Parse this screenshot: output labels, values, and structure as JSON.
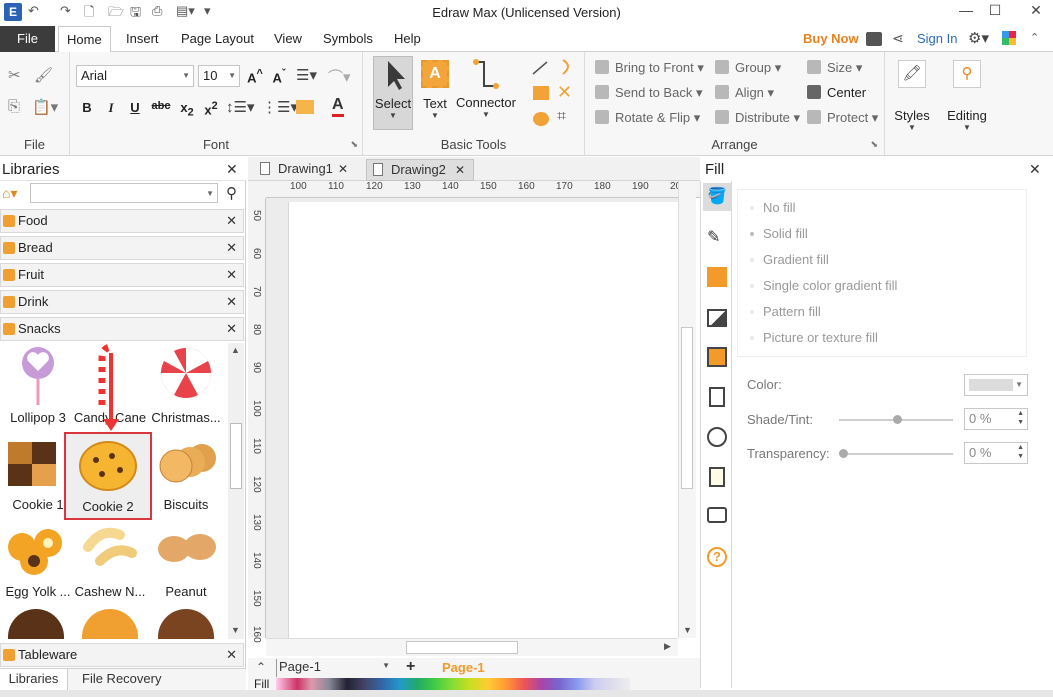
{
  "app": {
    "title": "Edraw Max (Unlicensed Version)"
  },
  "menu": {
    "file": "File",
    "tabs": [
      "Home",
      "Insert",
      "Page Layout",
      "View",
      "Symbols",
      "Help"
    ],
    "buy_now": "Buy Now",
    "sign_in": "Sign In"
  },
  "ribbon": {
    "file_group": "File",
    "font_group": "Font",
    "font_name": "Arial",
    "font_size": "10",
    "basic_tools_group": "Basic Tools",
    "select": "Select",
    "text": "Text",
    "connector": "Connector",
    "arrange_group": "Arrange",
    "bring_to_front": "Bring to Front",
    "send_to_back": "Send to Back",
    "rotate_flip": "Rotate & Flip",
    "group": "Group",
    "align": "Align",
    "distribute": "Distribute",
    "size": "Size",
    "center": "Center",
    "protect": "Protect",
    "styles": "Styles",
    "editing": "Editing"
  },
  "libraries": {
    "title": "Libraries",
    "categories": [
      "Food",
      "Bread",
      "Fruit",
      "Drink",
      "Snacks"
    ],
    "shapes": [
      "Lollipop 3",
      "Candy Cane",
      "Christmas...",
      "Cookie 1",
      "Cookie 2",
      "Biscuits",
      "Egg Yolk ...",
      "Cashew N...",
      "Peanut"
    ],
    "tableware": "Tableware",
    "bottom_tabs": [
      "Libraries",
      "File Recovery"
    ]
  },
  "documents": {
    "tabs": [
      "Drawing1",
      "Drawing2"
    ],
    "ruler_top": [
      "100",
      "110",
      "120",
      "130",
      "140",
      "150",
      "160",
      "170",
      "180",
      "190",
      "20"
    ],
    "ruler_left": [
      "50",
      "60",
      "70",
      "80",
      "90",
      "100",
      "110",
      "120",
      "130",
      "140",
      "150",
      "160"
    ],
    "page_selector": "Page-1",
    "active_page": "Page-1",
    "fill_label": "Fill"
  },
  "fill_panel": {
    "title": "Fill",
    "options": [
      "No fill",
      "Solid fill",
      "Gradient fill",
      "Single color gradient fill",
      "Pattern fill",
      "Picture or texture fill"
    ],
    "color_label": "Color:",
    "shade_label": "Shade/Tint:",
    "shade_value": "0 %",
    "transparency_label": "Transparency:",
    "transparency_value": "0 %"
  },
  "colors": {
    "accent": "#f29b2b",
    "file_tab": "#3c3c3c",
    "buy_now": "#e8821e",
    "sign_in": "#2b6cb5",
    "highlight": "#d9363e"
  }
}
